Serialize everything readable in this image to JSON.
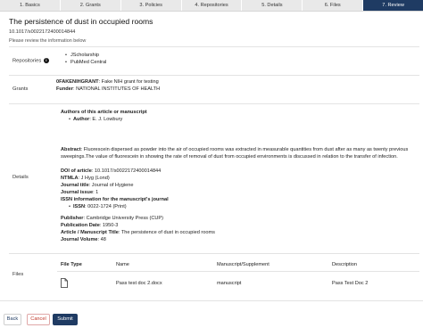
{
  "steps": [
    "1. Basics",
    "2. Grants",
    "3. Policies",
    "4. Repositories",
    "5. Details",
    "6. Files",
    "7. Review"
  ],
  "title": "The persistence of dust in occupied rooms",
  "doi": "10.1017/s0022172400014844",
  "hint": "Please review the information below",
  "repositories": {
    "label": "Repositories",
    "items": [
      "JScholarship",
      "PubMed Central"
    ]
  },
  "grants": {
    "label": "Grants",
    "id": "0FAKENIHGRANT",
    "description": ": Fake NIH grant for testing",
    "funder_label": "Funder",
    "funder": ": NATIONAL INSTITUTES OF HEALTH"
  },
  "details": {
    "label": "Details",
    "authors_heading": "Authors of this article or manuscript",
    "author_label": "Author",
    "author": ": E. J. Lowbury",
    "abstract_label": "Abstract",
    "abstract": ": Fluorescein dispersed as powder into the air of occupied rooms was extracted in measurable quantities from dust after as many as twenty previous sweepings.The value of fluorescein in showing the rate of removal of dust from occupied environments is discussed in relation to the transfer of infection.",
    "doi_label": "DOI of article",
    "doi": ": 10.1017/s0022172400014844",
    "nlmta_label": "NTMLA",
    "nlmta": ": J Hyg (Lond)",
    "journal_title_label": "Journal title",
    "journal_title": ": Journal of Hygiene",
    "journal_issue_label": "Journal issue",
    "journal_issue": ": 1",
    "issn_heading": "ISSN information for the manuscript's journal",
    "issn_label": "ISSN",
    "issn": ": 0022-1724 (Print)",
    "publisher_label": "Publisher",
    "publisher": ": Cambridge University Press (CUP)",
    "pubdate_label": "Publication Date",
    "pubdate": ": 1950-3",
    "article_title_label": "Article / Manuscript Title",
    "article_title": ": The persistence of dust in occupied rooms",
    "volume_label": "Journal Volume",
    "volume": ": 48"
  },
  "files": {
    "label": "Files",
    "headers": [
      "File Type",
      "Name",
      "Manuscript/Supplement",
      "Description"
    ],
    "row": {
      "icon": "document-icon",
      "name": "Pass test doc 2.docx",
      "type": "manuscript",
      "description": "Pass Test Doc 2"
    }
  },
  "buttons": {
    "back": "Back",
    "cancel": "Cancel",
    "submit": "Submit"
  },
  "colors": {
    "active_step": "#1f3b63",
    "cancel": "#c0392b"
  }
}
